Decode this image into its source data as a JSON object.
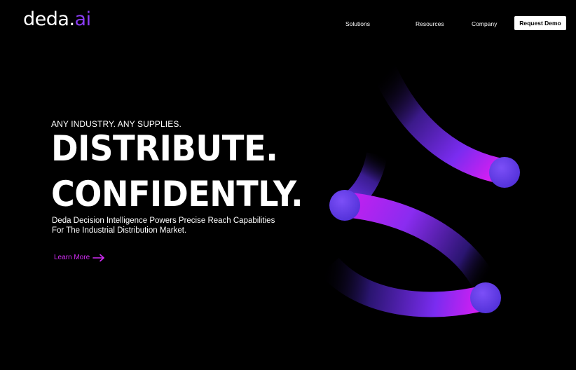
{
  "header": {
    "logo": {
      "text_main": "deda",
      "text_dot": ".",
      "text_accent": "ai"
    },
    "nav": [
      {
        "label": "Solutions"
      },
      {
        "label": "Resources"
      },
      {
        "label": "Company"
      }
    ],
    "cta_label": "Request Demo"
  },
  "hero": {
    "eyebrow": "ANY INDUSTRY.  ANY SUPPLIES.",
    "headline_line1": "DISTRIBUTE.",
    "headline_line2": "CONFIDENTLY.",
    "subhead_line1": "Deda Decision Intelligence Powers Precise Reach Capabilities",
    "subhead_line2": "For The Industrial Distribution Market.",
    "link_label": "Learn More",
    "link_icon": "arrow-right-icon"
  },
  "colors": {
    "background": "#000000",
    "accent_purple": "#8a3cf2",
    "accent_magenta": "#d12cf5",
    "sphere_color": "#6a3cf0"
  }
}
